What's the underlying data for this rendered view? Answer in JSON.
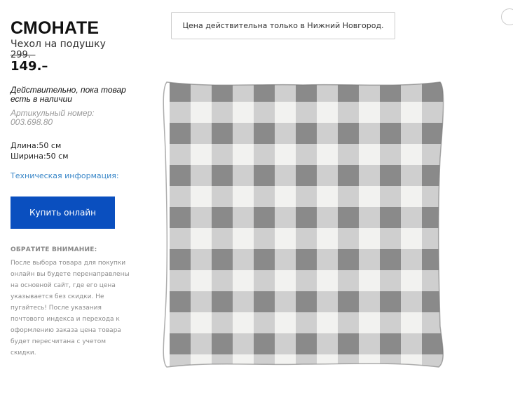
{
  "product": {
    "name": "СМОНАТЕ",
    "subtitle": "Чехол на подушку",
    "old_price": "299.–",
    "price": "149.–",
    "validity_note": "Действительно, пока товар есть в наличии",
    "article_number": "Артикульный номер: 003.698.80",
    "length": "Длина:50 см",
    "width": "Ширина:50 см",
    "tech_info_link": "Техническая информация:"
  },
  "buy_button_label": "Купить онлайн",
  "notice": {
    "heading": "ОБРАТИТЕ ВНИМАНИЕ:",
    "text": "После выбора товара для покупки онлайн вы будете перенаправлены на основной сайт, где его цена указывается без скидки. Не пугайтесь! После указания почтового индекса и перехода к оформлению заказа цена товара будет пересчитана с учетом скидки."
  },
  "city_banner": "Цена действительна только в Нижний Новгород.",
  "colors": {
    "buy_button": "#0a4fbf",
    "link": "#3a87c8",
    "pillow_dark": "#8f8f8f",
    "pillow_mid": "#cfcfcf",
    "pillow_light": "#f2f2f0"
  }
}
